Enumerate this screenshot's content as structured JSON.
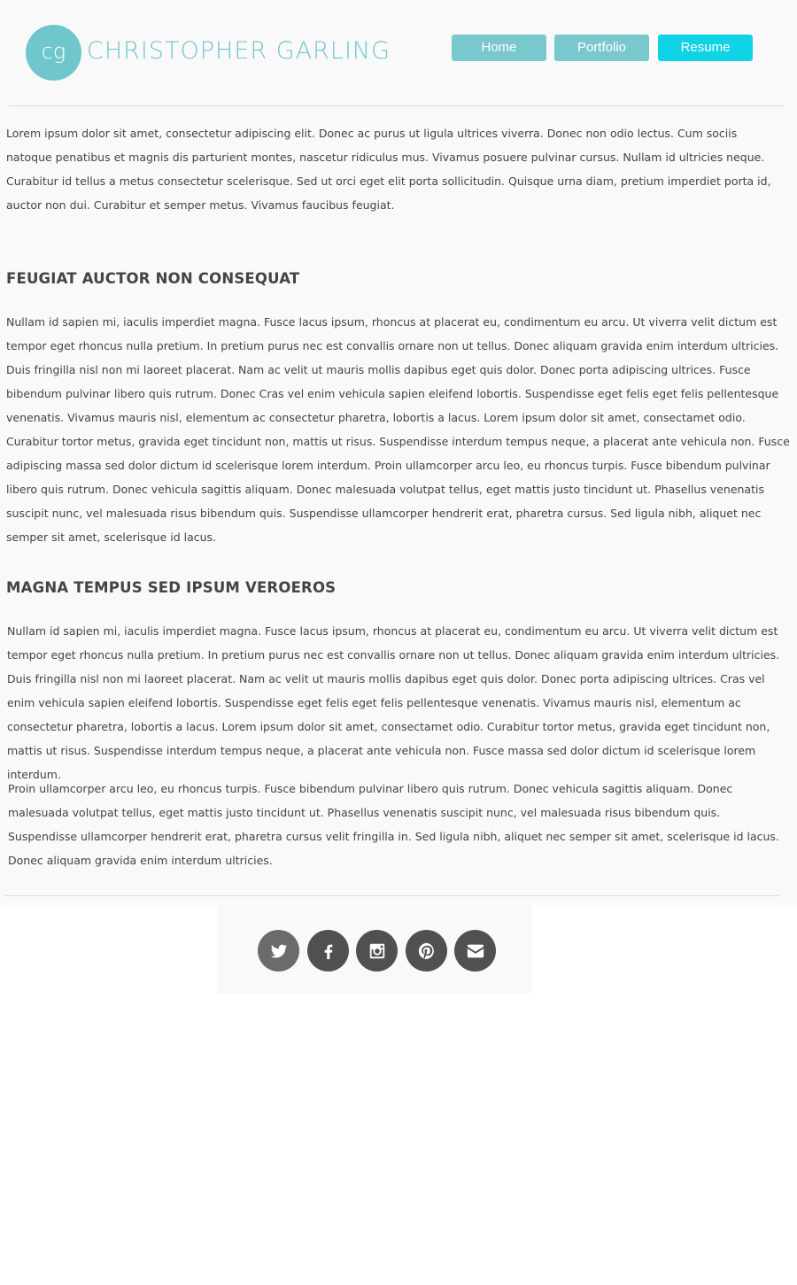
{
  "header": {
    "logo_initials": "cg",
    "logo_name": "CHRISTOPHER GARLING"
  },
  "nav": {
    "items": [
      {
        "label": "Home"
      },
      {
        "label": "Portfolio"
      },
      {
        "label": "Resume"
      }
    ],
    "active": "Resume"
  },
  "content": {
    "intro": "Lorem ipsum dolor sit amet, consectetur adipiscing elit. Donec ac purus ut ligula ultrices viverra. Donec non odio lectus. Cum sociis natoque penatibus et magnis dis parturient montes, nascetur ridiculus mus. Vivamus posuere pulvinar cursus. Nullam id ultricies neque. Curabitur id tellus a metus consectetur scelerisque. Sed ut orci eget elit porta sollicitudin. Quisque urna diam, pretium imperdiet porta id, auctor non dui. Curabitur et semper metus. Vivamus faucibus feugiat.",
    "section1": {
      "heading": "FEUGIAT AUCTOR NON CONSEQUAT",
      "body": "Nullam id sapien mi, iaculis imperdiet magna. Fusce lacus ipsum, rhoncus at placerat eu, condimentum eu arcu. Ut viverra velit dictum est tempor eget rhoncus nulla pretium. In pretium purus nec est convallis ornare non ut tellus. Donec aliquam gravida enim interdum ultricies. Duis fringilla nisl non mi laoreet placerat. Nam ac velit ut mauris mollis dapibus eget quis dolor. Donec porta adipiscing ultrices. Fusce bibendum pulvinar libero quis rutrum. Donec Cras vel enim vehicula sapien eleifend lobortis. Suspendisse eget felis eget felis pellentesque venenatis. Vivamus mauris nisl, elementum ac consectetur pharetra, lobortis a lacus. Lorem ipsum dolor sit amet, consectamet odio. Curabitur tortor metus, gravida eget tincidunt non, mattis ut risus. Suspendisse interdum tempus neque, a placerat ante vehicula non. Fusce adipiscing massa sed dolor dictum id scelerisque lorem interdum. Proin ullamcorper arcu leo, eu rhoncus turpis. Fusce bibendum pulvinar libero quis rutrum. Donec vehicula sagittis aliquam. Donec malesuada volutpat tellus, eget mattis justo tincidunt ut. Phasellus venenatis suscipit nunc, vel malesuada risus bibendum quis. Suspendisse ullamcorper hendrerit erat, pharetra cursus. Sed ligula nibh, aliquet nec semper sit amet, scelerisque id lacus."
    },
    "section2": {
      "heading": "MAGNA TEMPUS SED IPSUM VEROEROS",
      "body": "Nullam id sapien mi, iaculis imperdiet magna. Fusce lacus ipsum, rhoncus at placerat eu, condimentum eu arcu. Ut viverra velit dictum est tempor eget rhoncus nulla pretium. In pretium purus nec est convallis ornare non ut tellus. Donec aliquam gravida enim interdum ultricies. Duis fringilla nisl non mi laoreet placerat. Nam ac velit ut mauris mollis dapibus eget quis dolor. Donec porta adipiscing ultrices. Cras vel enim vehicula sapien eleifend lobortis. Suspendisse eget felis eget felis pellentesque venenatis. Vivamus mauris nisl, elementum ac consectetur pharetra, lobortis a lacus. Lorem ipsum dolor sit amet, consectamet odio. Curabitur tortor metus, gravida eget tincidunt non, mattis ut risus. Suspendisse interdum tempus neque, a placerat ante vehicula non. Fusce massa sed dolor dictum id scelerisque lorem interdum.",
      "body2": "Proin ullamcorper arcu leo, eu rhoncus turpis. Fusce bibendum pulvinar libero quis rutrum. Donec vehicula sagittis aliquam. Donec malesuada volutpat tellus, eget mattis justo tincidunt ut. Phasellus venenatis suscipit nunc, vel malesuada risus bibendum quis. Suspendisse ullamcorper hendrerit erat, pharetra cursus velit fringilla in. Sed ligula nibh, aliquet nec semper sit amet, scelerisque id lacus. Donec aliquam gravida enim interdum ultricies."
    }
  },
  "footer": {
    "social": [
      {
        "icon": "twitter-icon"
      },
      {
        "icon": "facebook-icon"
      },
      {
        "icon": "instagram-icon"
      },
      {
        "icon": "pinterest-icon"
      },
      {
        "icon": "email-icon"
      }
    ]
  },
  "colors": {
    "brand": "#6fc7cc",
    "nav_button": "#79c8cd",
    "nav_active": "#10d3e6",
    "text": "#444444",
    "social_bg": "#505050"
  }
}
